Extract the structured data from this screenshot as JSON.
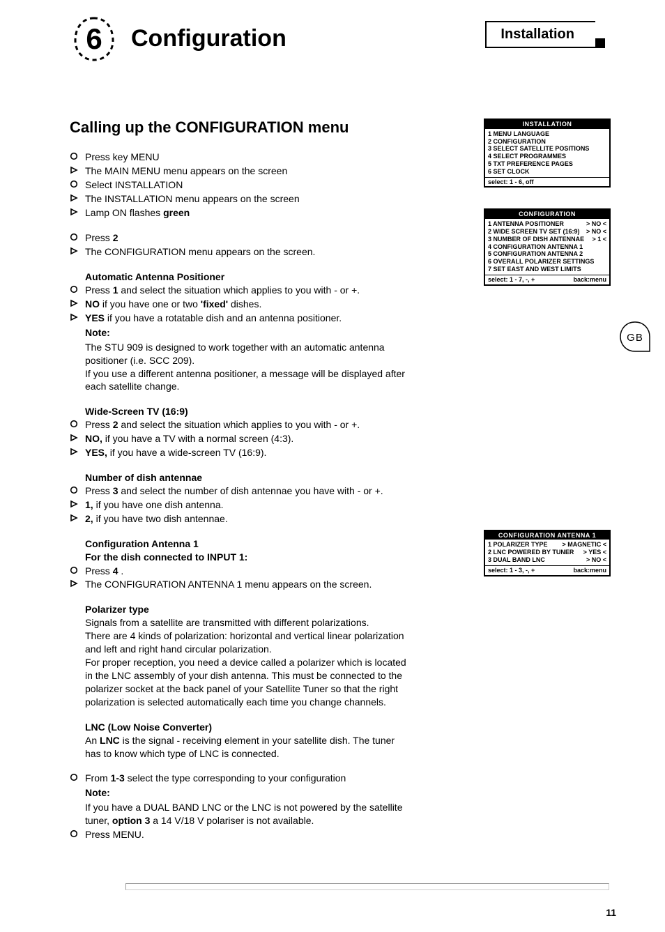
{
  "header": {
    "breadcrumb_label": "Installation",
    "chapter_number_glyph": "6",
    "chapter_title": "Configuration"
  },
  "section": {
    "title": "Calling up the CONFIGURATION menu"
  },
  "steps_intro": [
    {
      "icon": "circle",
      "html": "Press key MENU"
    },
    {
      "icon": "tri",
      "html": "The MAIN MENU menu appears on the screen"
    },
    {
      "icon": "circle",
      "html": "Select INSTALLATION"
    },
    {
      "icon": "tri",
      "html": "The INSTALLATION menu appears on the screen"
    },
    {
      "icon": "tri",
      "html": "Lamp ON flashes <b>green</b>"
    }
  ],
  "steps_press2": [
    {
      "icon": "circle",
      "html": "Press <b>2</b>"
    },
    {
      "icon": "tri",
      "html": "The CONFIGURATION menu appears on the screen."
    }
  ],
  "auto_ant": {
    "heading": "Automatic Antenna Positioner",
    "steps": [
      {
        "icon": "circle",
        "html": "Press <b>1</b> and select the situation which applies to you with - or +."
      },
      {
        "icon": "tri",
        "html": "<b>NO</b> if you have one or two <b>'fixed'</b> dishes."
      },
      {
        "icon": "tri",
        "html": "<b>YES</b> if you have a rotatable dish and an antenna positioner."
      }
    ],
    "note_label": "Note:",
    "note_body": "The STU 909 is designed to work together with an automatic antenna positioner (i.e. SCC 209).\nIf you use a different  antenna positioner, a message will be displayed after each satellite change."
  },
  "wide": {
    "heading": "Wide-Screen TV (16:9)",
    "steps": [
      {
        "icon": "circle",
        "html": "Press <b>2</b> and select the situation which applies to you with - or +."
      },
      {
        "icon": "tri",
        "html": "<b>NO,</b>  if you have a TV with a normal screen (4:3)."
      },
      {
        "icon": "tri",
        "html": "<b>YES,</b>  if you have a wide-screen TV (16:9)."
      }
    ]
  },
  "num_dish": {
    "heading": "Number of dish antennae",
    "steps": [
      {
        "icon": "circle",
        "html": "Press  <b>3</b> and select the number of dish antennae you have with - or +."
      },
      {
        "icon": "tri",
        "html": "<b>1,</b>  if you have one dish antenna."
      },
      {
        "icon": "tri",
        "html": "<b>2,</b>  if you have two dish antennae."
      }
    ]
  },
  "conf_ant1": {
    "heading": "Configuration Antenna 1",
    "sub": "For the dish connected to INPUT 1:",
    "steps": [
      {
        "icon": "circle",
        "html": "Press <b>4</b> ."
      },
      {
        "icon": "tri",
        "html": "The CONFIGURATION ANTENNA 1 menu appears on the screen."
      }
    ]
  },
  "polarizer": {
    "heading": "Polarizer type",
    "body": "Signals from a satellite are transmitted with different polarizations.\nThere are 4 kinds of polarization: horizontal and vertical linear polarization and left and right hand circular polarization.\nFor proper reception, you need a device called a polarizer which is located in the LNC assembly of your dish antenna. This must be connected to the polarizer socket at the back panel of your Satellite Tuner so that the right polarization is selected automatically each time you change channels."
  },
  "lnc": {
    "heading": "LNC (Low Noise Converter)",
    "body_html": "An <b>LNC</b> is the signal - receiving element in your satellite dish. The tuner has to know which type of LNC is connected."
  },
  "final_steps": [
    {
      "icon": "circle",
      "html": "From <b>1-3</b> select the type corresponding to your configuration"
    }
  ],
  "final_note_label": "Note:",
  "final_note_html": "If you have a DUAL BAND LNC or the LNC is not powered by the satellite tuner, <b>option 3</b>  a  14 V/18 V polariser is not available.",
  "final_steps2": [
    {
      "icon": "circle",
      "html": "Press MENU."
    }
  ],
  "osd_installation": {
    "title": "INSTALLATION",
    "rows": [
      {
        "l": "1 MENU LANGUAGE",
        "r": ""
      },
      {
        "l": "2 CONFIGURATION",
        "r": ""
      },
      {
        "l": "3 SELECT SATELLITE POSITIONS",
        "r": ""
      },
      {
        "l": "4 SELECT PROGRAMMES",
        "r": ""
      },
      {
        "l": "5 TXT PREFERENCE PAGES",
        "r": ""
      },
      {
        "l": "6 SET CLOCK",
        "r": ""
      }
    ],
    "foot_l": "select: 1 - 6, off",
    "foot_r": ""
  },
  "osd_configuration": {
    "title": "CONFIGURATION",
    "rows": [
      {
        "l": "1 ANTENNA POSITIONER",
        "r": "> NO <"
      },
      {
        "l": "2 WIDE SCREEN TV SET (16:9)",
        "r": "> NO <"
      },
      {
        "l": "3 NUMBER OF DISH ANTENNAE",
        "r": "> 1 <"
      },
      {
        "l": "4 CONFIGURATION ANTENNA 1",
        "r": ""
      },
      {
        "l": "5 CONFIGURATION ANTENNA 2",
        "r": ""
      },
      {
        "l": "6 OVERALL POLARIZER SETTINGS",
        "r": ""
      },
      {
        "l": "7 SET EAST AND WEST LIMITS",
        "r": ""
      }
    ],
    "foot_l": "select: 1 - 7, -, +",
    "foot_r": "back:menu"
  },
  "osd_conf_ant1": {
    "title": "CONFIGURATION ANTENNA 1",
    "rows": [
      {
        "l": "1 POLARIZER TYPE",
        "r": "> MAGNETIC <"
      },
      {
        "l": "2 LNC POWERED BY TUNER",
        "r": "> YES <"
      },
      {
        "l": "3 DUAL BAND LNC",
        "r": "> NO <"
      }
    ],
    "foot_l": "select: 1 - 3, -, +",
    "foot_r": "back:menu"
  },
  "gb_label": "GB",
  "page_number": "11"
}
